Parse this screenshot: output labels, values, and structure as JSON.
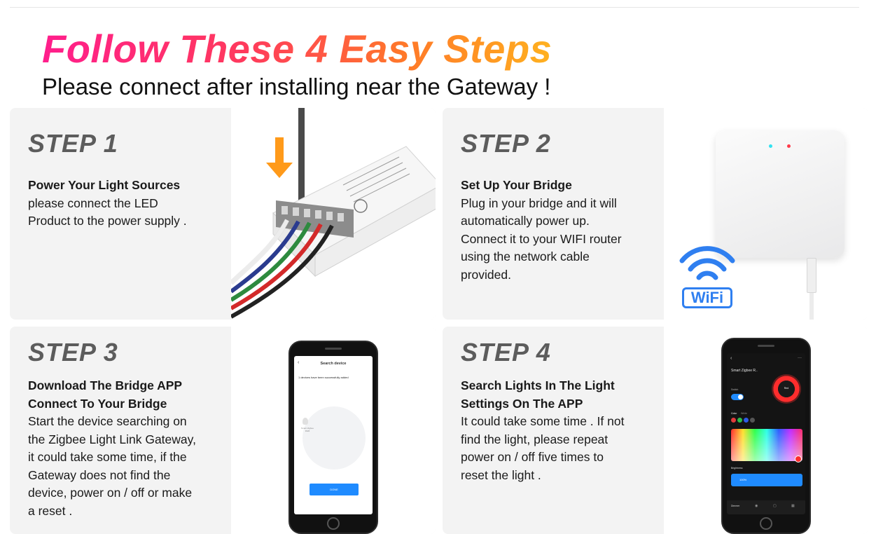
{
  "header": {
    "title": "Follow These 4 Easy Steps",
    "subtitle": "Please connect after installing near the Gateway !"
  },
  "steps": [
    {
      "title": "STEP 1",
      "heading": "Power Your Light Sources",
      "body": "please connect the LED\nProduct to the power supply ."
    },
    {
      "title": "STEP 2",
      "heading": "Set Up Your Bridge",
      "body": "Plug in your bridge and it will\nautomatically power up.\nConnect it to your WIFI router\nusing the network cable\nprovided."
    },
    {
      "title": "STEP 3",
      "heading": "Download The Bridge APP\nConnect To Your Bridge",
      "body": "Start the device searching on\nthe Zigbee Light Link Gateway,\nit could take some time, if the\nGateway does not find the\ndevice, power on / off or make\na reset ."
    },
    {
      "title": "STEP 4",
      "heading": "Search Lights In The Light\nSettings On The APP",
      "body": "It could take some time . If not\nfind the light, please repeat\npower on / off five times to\nreset the light ."
    }
  ],
  "wifi_badge": "WiFi",
  "phone3": {
    "header": "Search device",
    "message": "1 devices have been successfully added",
    "device_label": "Smart Zigbee RGB",
    "button": "DONE"
  },
  "phone4": {
    "title": "Smart Zigbee R..",
    "switch_label": "Switch",
    "color_tab": "Color",
    "white_tab": "White",
    "knob_label": "Red",
    "brightness_label": "Brightness",
    "brightness_value": "100%",
    "nav_label": "Dimmer"
  },
  "colors": {
    "title_gradient": [
      "#ff1e8c",
      "#ff7a28",
      "#ffb11f"
    ],
    "arrow": "#ff9a1a",
    "wifi_blue": "#2f7ff0",
    "accent_blue": "#1f8bff"
  }
}
